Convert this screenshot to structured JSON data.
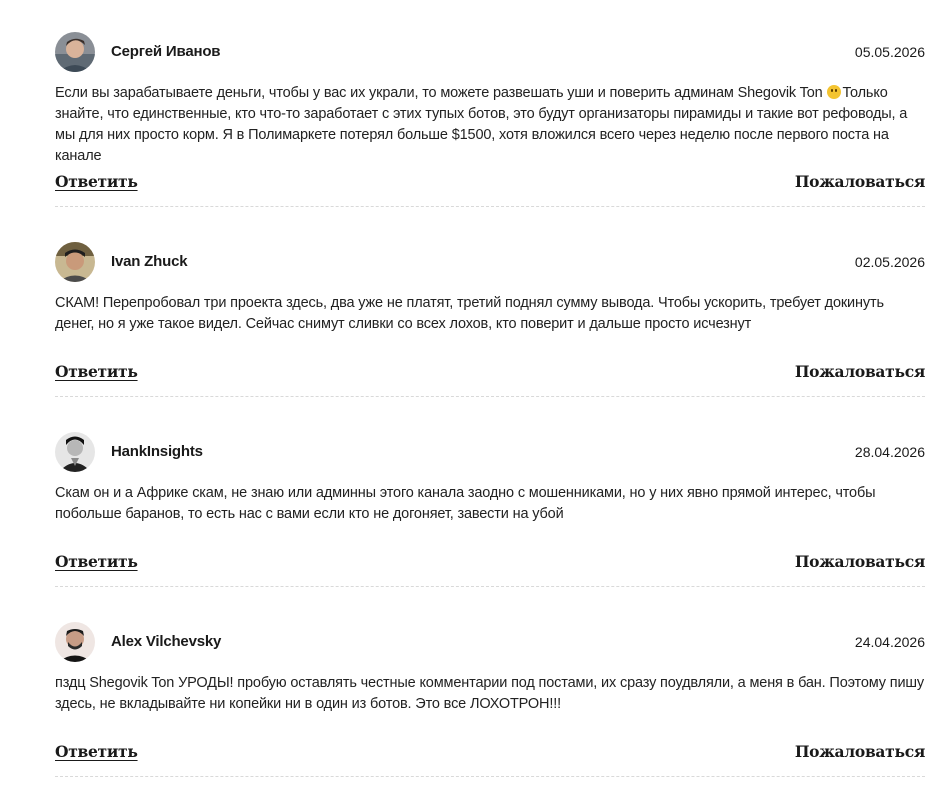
{
  "actions": {
    "reply_label": "Ответить",
    "report_label": "Пожаловаться"
  },
  "comments": [
    {
      "author": "Сергей Иванов",
      "date": "05.05.2026",
      "text_before_emoji": "Если вы зарабатываете деньги, чтобы у вас их украли, то можете развешать уши и поверить админам Shegovik Ton ",
      "emoji": "smiling-face",
      "text_after_emoji": "Только знайте, что единственные, кто что-то заработает с этих тупых ботов, это будут организаторы пирамиды и такие вот рефоводы, а мы для них просто корм. Я в Полимаркете потерял больше $1500, хотя вложился всего через неделю после первого поста на канале"
    },
    {
      "author": "Ivan Zhuck",
      "date": "02.05.2026",
      "text": "СКАМ! Перепробовал три проекта здесь, два уже не платят, третий поднял сумму вывода. Чтобы ускорить, требует докинуть денег, но я уже такое видел. Сейчас снимут сливки со всех лохов, кто поверит и дальше просто исчезнут"
    },
    {
      "author": "HankInsights",
      "date": "28.04.2026",
      "text": "Скам он и а Африке скам, не знаю или админны этого канала заодно с мошенниками, но у них явно прямой интерес, чтобы побольше баранов, то есть нас с вами если кто не догоняет, завести на убой"
    },
    {
      "author": "Alex Vilchevsky",
      "date": "24.04.2026",
      "text": "пздц Shegovik Ton УРОДЫ! пробую оставлять честные комментарии под постами, их сразу поудвляли, а меня в бан. Поэтому пишу здесь, не вкладывайте ни копейки ни в один из ботов. Это все ЛОХОТРОН!!!"
    }
  ]
}
